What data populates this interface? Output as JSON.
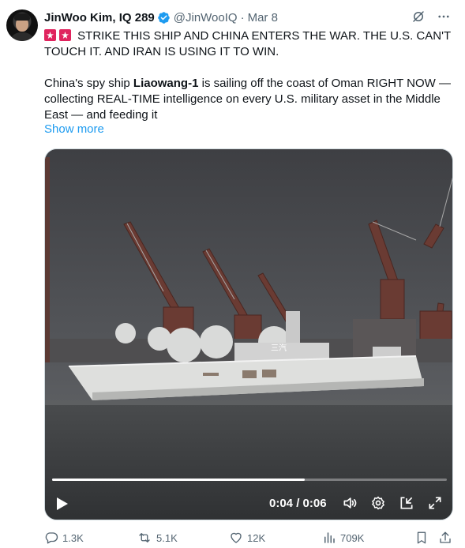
{
  "author": {
    "name": "JinWoo Kim, IQ 289",
    "handle": "@JinWooIQ",
    "separator": "·",
    "date": "Mar 8"
  },
  "icons": {
    "verified": "verified-badge-icon",
    "grok": "grok-icon",
    "more": "more-options-icon",
    "siren": "police-light-emoji",
    "play": "play-icon",
    "volume": "volume-icon",
    "settings": "settings-gear-icon",
    "pip": "picture-in-picture-icon",
    "fullscreen": "fullscreen-icon",
    "reply": "reply-icon",
    "retweet": "retweet-icon",
    "like": "heart-icon",
    "views": "views-chart-icon",
    "bookmark": "bookmark-icon",
    "share": "share-icon"
  },
  "tweet": {
    "line1": "STRIKE THIS SHIP AND CHINA ENTERS THE WAR. THE U.S. CAN'T TOUCH IT. AND IRAN IS USING IT TO WIN.",
    "p2_before": "China's spy ship ",
    "p2_bold": "Liaowang-1",
    "p2_after": " is sailing off the coast of Oman RIGHT NOW — collecting REAL-TIME intelligence on every U.S. military asset in the Middle East — and feeding it",
    "show_more": "Show more"
  },
  "video": {
    "time": "0:04 / 0:06",
    "progress": 0.64,
    "hull_text": "三汽"
  },
  "stats": {
    "replies": "1.3K",
    "retweets": "5.1K",
    "likes": "12K",
    "views": "709K"
  },
  "colors": {
    "accent": "#1d9bf0",
    "text": "#0f1419",
    "muted": "#536471",
    "siren": "#e0245e"
  }
}
